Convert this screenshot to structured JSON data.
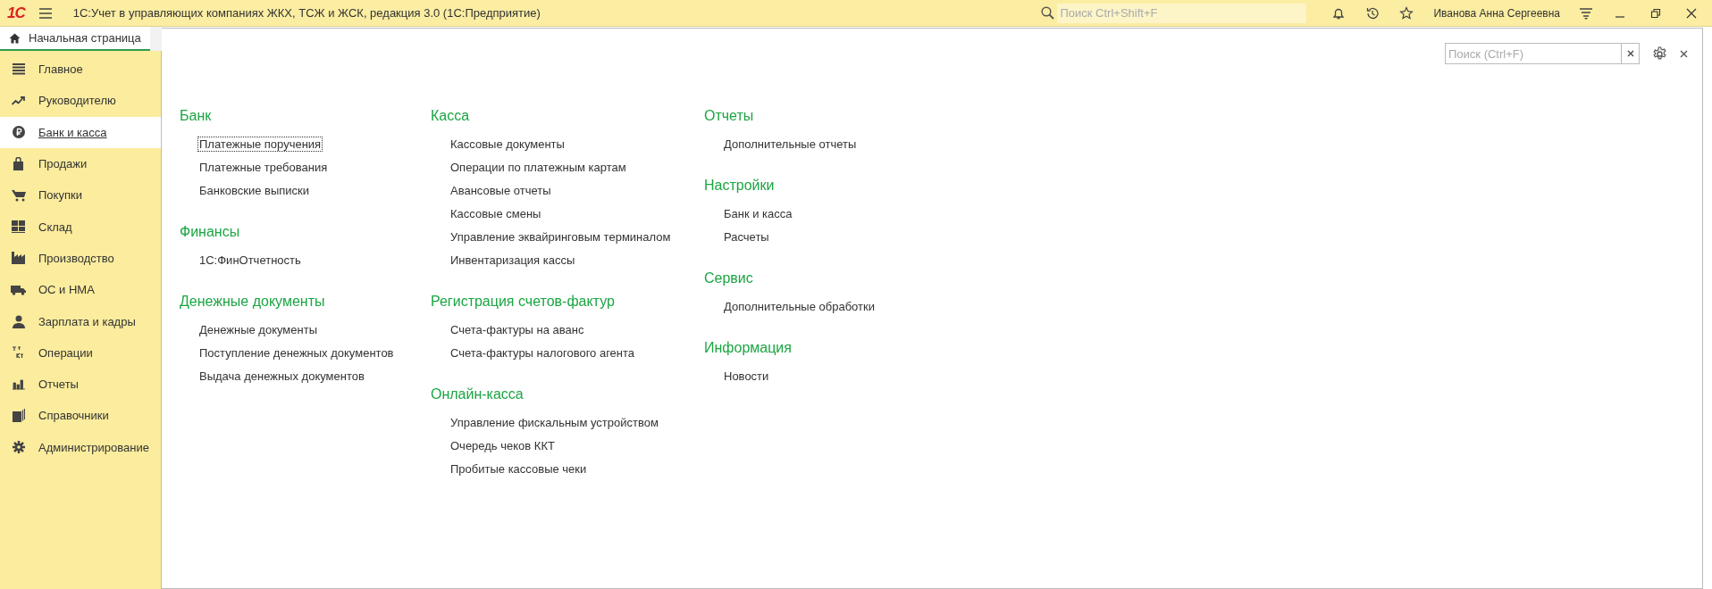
{
  "app_bar": {
    "logo": "1С",
    "title": "1С:Учет в управляющих компаниях ЖКХ, ТСЖ и ЖСК, редакция 3.0  (1С:Предприятие)",
    "search": {
      "placeholder": "Поиск Ctrl+Shift+F"
    },
    "user": "Иванова Анна Сергеевна"
  },
  "tabs": [
    {
      "label": "Начальная страница",
      "selected": true
    }
  ],
  "sidebar": {
    "items": [
      {
        "label": "Главное",
        "selected": false
      },
      {
        "label": "Руководителю",
        "selected": false
      },
      {
        "label": "Банк и касса",
        "selected": true
      },
      {
        "label": "Продажи",
        "selected": false
      },
      {
        "label": "Покупки",
        "selected": false
      },
      {
        "label": "Склад",
        "selected": false
      },
      {
        "label": "Производство",
        "selected": false
      },
      {
        "label": "ОС и НМА",
        "selected": false
      },
      {
        "label": "Зарплата и кадры",
        "selected": false
      },
      {
        "label": "Операции",
        "selected": false
      },
      {
        "label": "Отчеты",
        "selected": false
      },
      {
        "label": "Справочники",
        "selected": false
      },
      {
        "label": "Администрирование",
        "selected": false
      }
    ]
  },
  "panel": {
    "search": {
      "placeholder": "Поиск (Ctrl+F)"
    },
    "columns": [
      [
        {
          "title": "Банк",
          "items": [
            {
              "label": "Платежные поручения",
              "focused": true
            },
            {
              "label": "Платежные требования",
              "focused": false
            },
            {
              "label": "Банковские выписки",
              "focused": false
            }
          ]
        },
        {
          "title": "Финансы",
          "items": [
            {
              "label": "1С:ФинОтчетность",
              "focused": false
            }
          ]
        },
        {
          "title": "Денежные документы",
          "items": [
            {
              "label": "Денежные документы",
              "focused": false
            },
            {
              "label": "Поступление денежных документов",
              "focused": false
            },
            {
              "label": "Выдача денежных документов",
              "focused": false
            }
          ]
        }
      ],
      [
        {
          "title": "Касса",
          "items": [
            {
              "label": "Кассовые документы",
              "focused": false
            },
            {
              "label": "Операции по платежным картам",
              "focused": false
            },
            {
              "label": "Авансовые отчеты",
              "focused": false
            },
            {
              "label": "Кассовые смены",
              "focused": false
            },
            {
              "label": "Управление эквайринговым терминалом",
              "focused": false
            },
            {
              "label": "Инвентаризация кассы",
              "focused": false
            }
          ]
        },
        {
          "title": "Регистрация счетов-фактур",
          "items": [
            {
              "label": "Счета-фактуры на аванс",
              "focused": false
            },
            {
              "label": "Счета-фактуры налогового агента",
              "focused": false
            }
          ]
        },
        {
          "title": "Онлайн-касса",
          "items": [
            {
              "label": "Управление фискальным устройством",
              "focused": false
            },
            {
              "label": "Очередь чеков ККТ",
              "focused": false
            },
            {
              "label": "Пробитые кассовые чеки",
              "focused": false
            }
          ]
        }
      ],
      [
        {
          "title": "Отчеты",
          "items": [
            {
              "label": "Дополнительные отчеты",
              "focused": false
            }
          ]
        },
        {
          "title": "Настройки",
          "items": [
            {
              "label": "Банк и касса",
              "focused": false
            },
            {
              "label": "Расчеты",
              "focused": false
            }
          ]
        },
        {
          "title": "Сервис",
          "items": [
            {
              "label": "Дополнительные обработки",
              "focused": false
            }
          ]
        },
        {
          "title": "Информация",
          "items": [
            {
              "label": "Новости",
              "focused": false
            }
          ]
        }
      ]
    ]
  }
}
